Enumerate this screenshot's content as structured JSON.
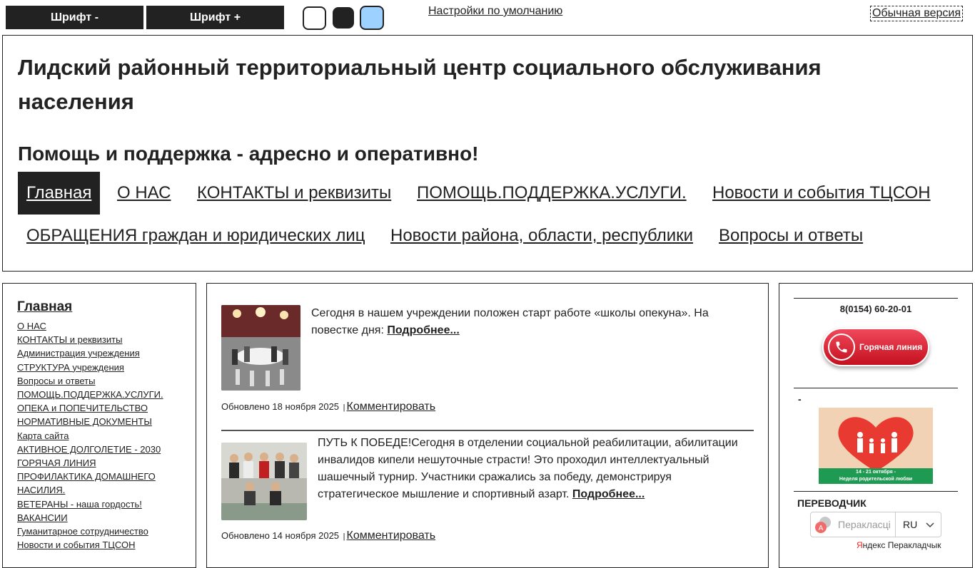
{
  "toolbar": {
    "font_minus": "Шрифт -",
    "font_plus": "Шрифт +",
    "theme_swatches": [
      {
        "name": "white",
        "color": "#ffffff"
      },
      {
        "name": "black",
        "color": "#222222"
      },
      {
        "name": "blue",
        "color": "#9dd1ff"
      }
    ],
    "reset_label": "Настройки по умолчанию",
    "normal_version_label": "Обычная версия"
  },
  "header": {
    "title": "Лидский районный территориальный центр социального обслуживания населения",
    "slogan": "Помощь и поддержка - адресно и оперативно!"
  },
  "nav": {
    "items": [
      {
        "label": "Главная",
        "active": true
      },
      {
        "label": "О НАС"
      },
      {
        "label": "КОНТАКТЫ и реквизиты"
      },
      {
        "label": "ПОМОЩЬ.ПОДДЕРЖКА.УСЛУГИ."
      },
      {
        "label": "Новости и события ТЦСОН"
      },
      {
        "label": "ОБРАЩЕНИЯ граждан и юридических лиц"
      },
      {
        "label": "Новости района, области, республики"
      },
      {
        "label": "Вопросы и ответы"
      }
    ]
  },
  "sidebar": {
    "title": "Главная",
    "items": [
      "О НАС",
      "КОНТАКТЫ и реквизиты",
      "Администрация учреждения",
      "СТРУКТУРА учреждения",
      "Вопросы и ответы",
      "ПОМОЩЬ.ПОДДЕРЖКА.УСЛУГИ.",
      "ОПЕКА и ПОПЕЧИТЕЛЬСТВО",
      "НОРМАТИВНЫЕ ДОКУМЕНТЫ",
      "Карта сайта",
      "АКТИВНОЕ ДОЛГОЛЕТИЕ - 2030",
      "ГОРЯЧАЯ ЛИНИЯ",
      "ПРОФИЛАКТИКА ДОМАШНЕГО НАСИЛИЯ.",
      "ВЕТЕРАНЫ - наша гордость!",
      "ВАКАНСИИ",
      "Гуманитарное сотрудничество",
      "Новости и события ТЦСОН"
    ]
  },
  "news": [
    {
      "text": "Сегодня в нашем учреждении положен старт работе «школы опекуна». На повестке дня: ",
      "more": "Подробнее...",
      "updated": "Обновлено 18 ноября 2025",
      "separator": "|",
      "comment": "Комментировать"
    },
    {
      "text": "ПУТЬ К ПОБЕДЕ!Сегодня в отделении социальной реабилитации, абилитации инвалидов кипели нешуточные страсти! Это проходил интеллектуальный шашечный турнир. Участники сражались за победу, демонстрируя стратегическое мышление и спортивный азарт. ",
      "more": "Подробнее...",
      "updated": "Обновлено 14 ноября 2025",
      "separator": "|",
      "comment": "Комментировать"
    }
  ],
  "right": {
    "phone": "8(0154) 60-20-01",
    "hotline_label": "Горячая линия",
    "dash": "-",
    "banner_caption_line1": "14 - 21 октября -",
    "banner_caption_line2": "Неделя родительской любви",
    "translator_title": "ПЕРЕВОДЧИК",
    "translator_label": "Перакласці",
    "translator_lang": "RU",
    "yandex_first": "Я",
    "yandex_rest": "ндекс Перакладчык"
  }
}
